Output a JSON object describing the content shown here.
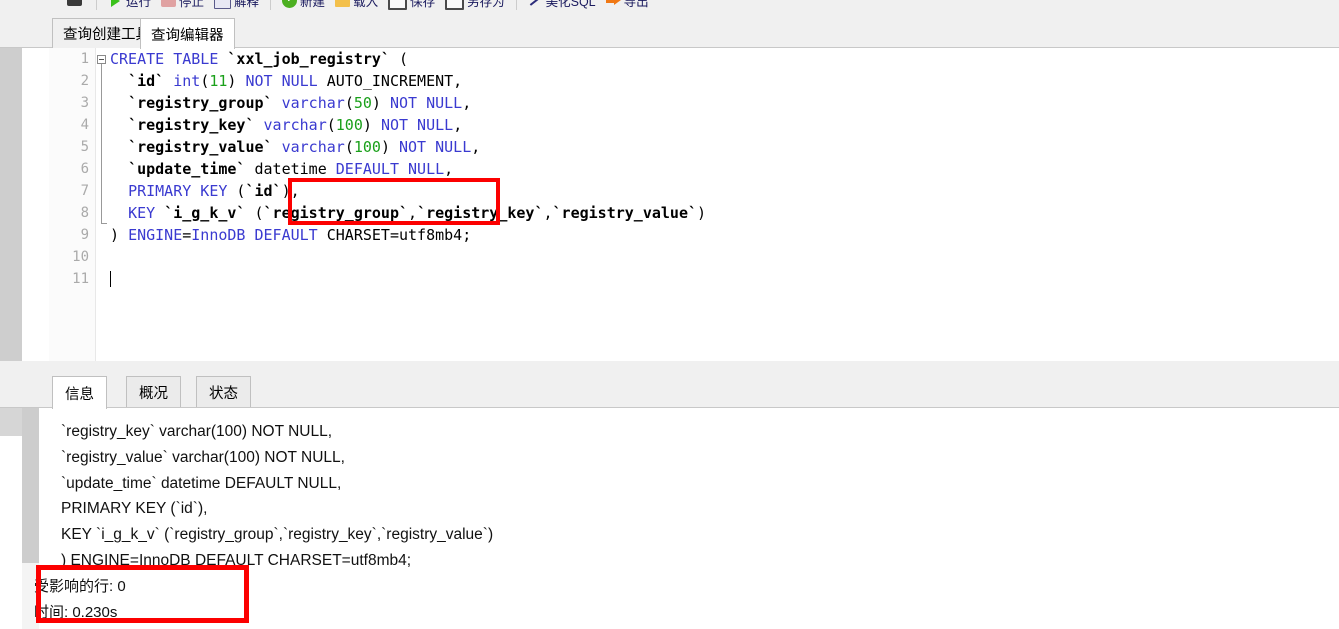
{
  "toolbar": {
    "items": [
      {
        "label": "",
        "icon": "database-icon"
      },
      {
        "label": "运行",
        "icon": "play-icon"
      },
      {
        "label": "停止",
        "icon": "stop-icon"
      },
      {
        "label": "解释",
        "icon": "explain-icon"
      },
      {
        "label": "新建",
        "icon": "new-icon"
      },
      {
        "label": "载入",
        "icon": "load-folder-icon"
      },
      {
        "label": "保存",
        "icon": "save-icon"
      },
      {
        "label": "另存为",
        "icon": "save-as-icon"
      },
      {
        "label": "美化SQL",
        "icon": "beautify-wand-icon"
      },
      {
        "label": "导出",
        "icon": "export-arrow-icon"
      }
    ]
  },
  "editor_tabs": {
    "query_builder": "查询创建工具",
    "query_editor": "查询编辑器",
    "active": "查询编辑器"
  },
  "editor": {
    "line_numbers": [
      "1",
      "2",
      "3",
      "4",
      "5",
      "6",
      "7",
      "8",
      "9",
      "10",
      "11"
    ],
    "lines": [
      {
        "n": 1,
        "tokens": [
          {
            "t": "CREATE TABLE ",
            "c": "kw"
          },
          {
            "t": "`xxl_job_registry`",
            "c": "tick"
          },
          {
            "t": " (",
            "c": "plain"
          }
        ]
      },
      {
        "n": 2,
        "tokens": [
          {
            "t": "  ",
            "c": "plain"
          },
          {
            "t": "`id`",
            "c": "tick"
          },
          {
            "t": " ",
            "c": "plain"
          },
          {
            "t": "int",
            "c": "kw"
          },
          {
            "t": "(",
            "c": "plain"
          },
          {
            "t": "11",
            "c": "num"
          },
          {
            "t": ") ",
            "c": "plain"
          },
          {
            "t": "NOT NULL",
            "c": "kw"
          },
          {
            "t": " AUTO_INCREMENT,",
            "c": "plain"
          }
        ]
      },
      {
        "n": 3,
        "tokens": [
          {
            "t": "  ",
            "c": "plain"
          },
          {
            "t": "`registry_group`",
            "c": "tick"
          },
          {
            "t": " ",
            "c": "plain"
          },
          {
            "t": "varchar",
            "c": "kw"
          },
          {
            "t": "(",
            "c": "plain"
          },
          {
            "t": "50",
            "c": "num"
          },
          {
            "t": ") ",
            "c": "plain"
          },
          {
            "t": "NOT NULL",
            "c": "kw"
          },
          {
            "t": ",",
            "c": "plain"
          }
        ]
      },
      {
        "n": 4,
        "tokens": [
          {
            "t": "  ",
            "c": "plain"
          },
          {
            "t": "`registry_key`",
            "c": "tick"
          },
          {
            "t": " ",
            "c": "plain"
          },
          {
            "t": "varchar",
            "c": "kw"
          },
          {
            "t": "(",
            "c": "plain"
          },
          {
            "t": "100",
            "c": "num"
          },
          {
            "t": ") ",
            "c": "plain"
          },
          {
            "t": "NOT NULL",
            "c": "kw"
          },
          {
            "t": ",",
            "c": "plain"
          }
        ]
      },
      {
        "n": 5,
        "tokens": [
          {
            "t": "  ",
            "c": "plain"
          },
          {
            "t": "`registry_value`",
            "c": "tick"
          },
          {
            "t": " ",
            "c": "plain"
          },
          {
            "t": "varchar",
            "c": "kw"
          },
          {
            "t": "(",
            "c": "plain"
          },
          {
            "t": "100",
            "c": "num"
          },
          {
            "t": ") ",
            "c": "plain"
          },
          {
            "t": "NOT NULL",
            "c": "kw"
          },
          {
            "t": ",",
            "c": "plain"
          }
        ]
      },
      {
        "n": 6,
        "tokens": [
          {
            "t": "  ",
            "c": "plain"
          },
          {
            "t": "`update_time`",
            "c": "tick"
          },
          {
            "t": " datetime ",
            "c": "plain"
          },
          {
            "t": "DEFAULT NULL",
            "c": "kw"
          },
          {
            "t": ",",
            "c": "plain"
          }
        ]
      },
      {
        "n": 7,
        "tokens": [
          {
            "t": "  ",
            "c": "plain"
          },
          {
            "t": "PRIMARY KEY",
            "c": "kw"
          },
          {
            "t": " (",
            "c": "plain"
          },
          {
            "t": "`id`",
            "c": "tick"
          },
          {
            "t": "),",
            "c": "plain"
          }
        ]
      },
      {
        "n": 8,
        "tokens": [
          {
            "t": "  ",
            "c": "plain"
          },
          {
            "t": "KEY",
            "c": "kw"
          },
          {
            "t": " ",
            "c": "plain"
          },
          {
            "t": "`i_g_k_v`",
            "c": "tick"
          },
          {
            "t": " (",
            "c": "plain"
          },
          {
            "t": "`registry_group`",
            "c": "tick"
          },
          {
            "t": ",",
            "c": "plain"
          },
          {
            "t": "`registry_key`",
            "c": "tick"
          },
          {
            "t": ",",
            "c": "plain"
          },
          {
            "t": "`registry_value`",
            "c": "tick"
          },
          {
            "t": ")",
            "c": "plain"
          }
        ]
      },
      {
        "n": 9,
        "tokens": [
          {
            "t": ") ",
            "c": "plain"
          },
          {
            "t": "ENGINE",
            "c": "kw"
          },
          {
            "t": "=",
            "c": "plain"
          },
          {
            "t": "InnoDB",
            "c": "kw"
          },
          {
            "t": " ",
            "c": "plain"
          },
          {
            "t": "DEFAULT",
            "c": "kw"
          },
          {
            "t": " CHARSET=utf8mb4;",
            "c": "plain"
          }
        ]
      },
      {
        "n": 10,
        "tokens": []
      },
      {
        "n": 11,
        "tokens": [],
        "caret": true
      }
    ]
  },
  "result_tabs": {
    "info": "信息",
    "profile": "概况",
    "status": "状态",
    "active": "信息"
  },
  "result_output": {
    "lines": [
      "`registry_key` varchar(100) NOT NULL,",
      "`registry_value` varchar(100) NOT NULL,",
      "`update_time` datetime DEFAULT NULL,",
      "PRIMARY KEY (`id`),",
      "KEY `i_g_k_v` (`registry_group`,`registry_key`,`registry_value`)",
      ") ENGINE=InnoDB DEFAULT CHARSET=utf8mb4;"
    ],
    "affected_rows": "受影响的行: 0",
    "time": "时间: 0.230s"
  },
  "annotations": {
    "highlight_color": "#fc0000",
    "boxes": [
      {
        "name": "varchar-100-highlight"
      },
      {
        "name": "execution-status-highlight"
      }
    ]
  }
}
